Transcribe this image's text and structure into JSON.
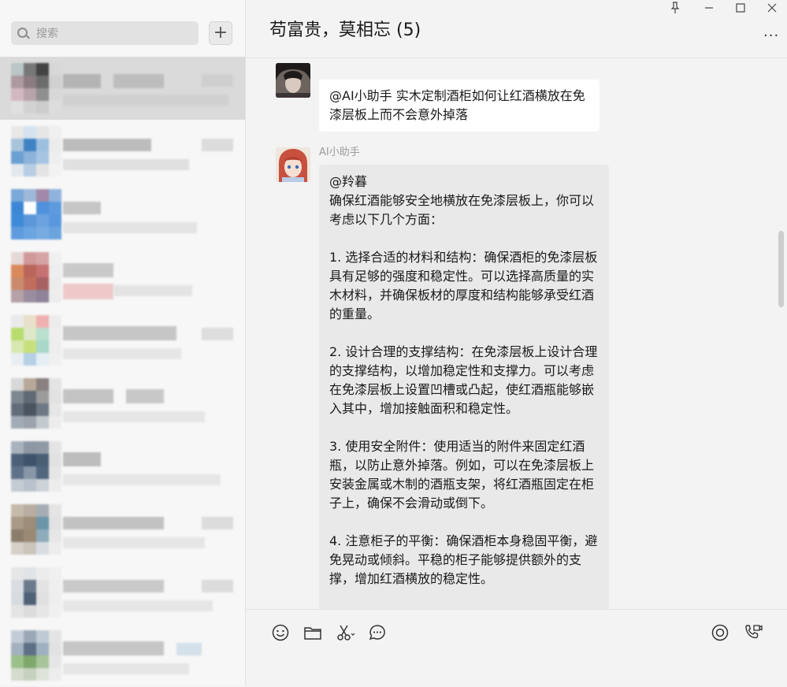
{
  "search": {
    "placeholder": "搜索"
  },
  "add_label": "+",
  "chat": {
    "title": "苟富贵，莫相忘 (5)",
    "more_label": "...",
    "messages": [
      {
        "text": "@AI小助手 实木定制酒柜如何让红酒横放在免漆层板上而不会意外掉落"
      },
      {
        "sender": "AI小助手",
        "text": "@羚暮\n确保红酒能够安全地横放在免漆层板上，你可以考虑以下几个方面：\n\n1. 选择合适的材料和结构：确保酒柜的免漆层板具有足够的强度和稳定性。可以选择高质量的实木材料，并确保板材的厚度和结构能够承受红酒的重量。\n\n2. 设计合理的支撑结构：在免漆层板上设计合理的支撑结构，以增加稳定性和支撑力。可以考虑在免漆层板上设置凹槽或凸起，使红酒瓶能够嵌入其中，增加接触面积和稳定性。\n\n3. 使用安全附件：使用适当的附件来固定红酒瓶，以防止意外掉落。例如，可以在免漆层板上安装金属或木制的酒瓶支架，将红酒瓶固定在柜子上，确保不会滑动或倒下。\n\n4. 注意柜子的平衡：确保酒柜本身稳固平衡，避免晃动或倾斜。平稳的柜子能够提供额外的支撑，增加红酒横放的稳定性。"
      }
    ]
  },
  "toolbar": {
    "left": [
      "emoji-icon",
      "folder-icon",
      "scissors-icon",
      "chat-history-icon"
    ],
    "right": [
      "live-icon",
      "video-call-icon"
    ]
  },
  "window": {
    "pin": "pin-icon",
    "minimize": "minimize-icon",
    "maximize": "maximize-icon",
    "close": "close-icon"
  }
}
